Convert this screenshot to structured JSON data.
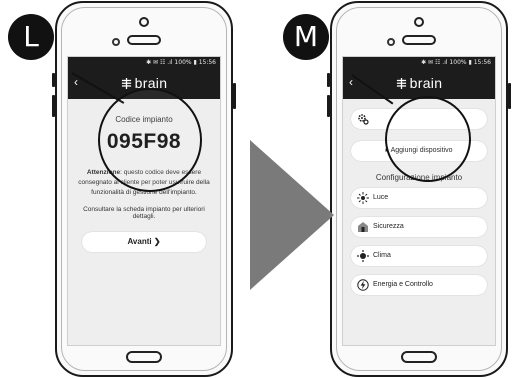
{
  "steps": {
    "left_badge": "L",
    "right_badge": "M"
  },
  "status_bar": {
    "text": "✱ ✉ ☷ .ıl 100% ▮ 15:56"
  },
  "app": {
    "logo_text": "brain",
    "back_icon": "chevron-left-icon"
  },
  "left_screen": {
    "code_label": "Codice impianto",
    "code_value": "095F98",
    "warning_bold": "Attenzione",
    "warning_text": ": questo codice deve essere consegnato al cliente per poter usufruire della funzionalità di gestione dell'impianto.",
    "note": "Consultare la scheda impianto per ulteriori dettagli.",
    "next_button": "Avanti ❯"
  },
  "right_screen": {
    "device_item_label": "",
    "add_device_button": "▸ Aggiungi dispositivo",
    "config_title": "Configurazione impianto",
    "categories": [
      {
        "label": "Luce",
        "icon": "light-icon"
      },
      {
        "label": "Sicurezza",
        "icon": "security-icon"
      },
      {
        "label": "Clima",
        "icon": "climate-icon"
      },
      {
        "label": "Energia e Controllo",
        "icon": "energy-icon"
      }
    ]
  },
  "colors": {
    "app_bar": "#1c1c1c",
    "screen_bg": "#eeeeee",
    "arrow": "#7a7a7a",
    "badge": "#111111"
  }
}
